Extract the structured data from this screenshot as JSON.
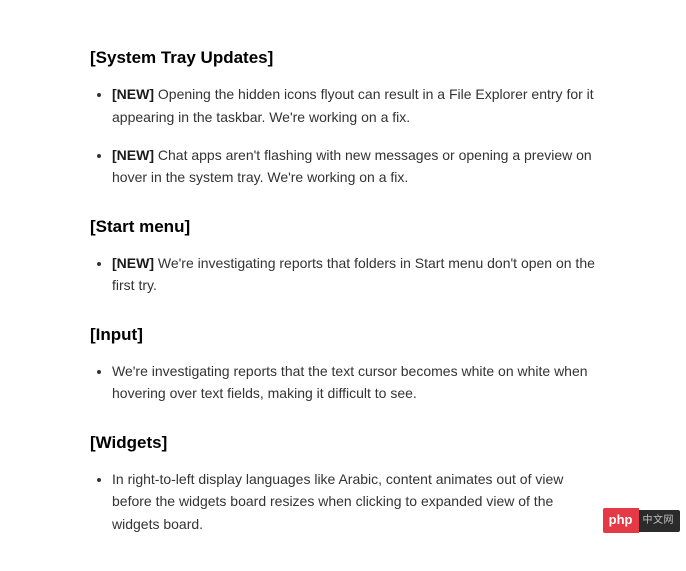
{
  "sections": [
    {
      "heading": "[System Tray Updates]",
      "items": [
        {
          "tag": "[NEW]",
          "text": " Opening the hidden icons flyout can result in a File Explorer entry for it appearing in the taskbar. We're working on a fix."
        },
        {
          "tag": "[NEW]",
          "text": " Chat apps aren't flashing with new messages or opening a preview on hover in the system tray. We're working on a fix."
        }
      ]
    },
    {
      "heading": "[Start menu]",
      "items": [
        {
          "tag": "[NEW]",
          "text": " We're investigating reports that folders in Start menu don't open on the first try."
        }
      ]
    },
    {
      "heading": "[Input]",
      "items": [
        {
          "tag": "",
          "text": "We're investigating reports that the text cursor becomes white on white when hovering over text fields, making it difficult to see."
        }
      ]
    },
    {
      "heading": "[Widgets]",
      "items": [
        {
          "tag": "",
          "text": "In right-to-left display languages like Arabic, content animates out of view before the widgets board resizes when clicking to expanded view of the widgets board."
        }
      ]
    }
  ],
  "watermark": {
    "left": "php",
    "right": "中文网"
  }
}
